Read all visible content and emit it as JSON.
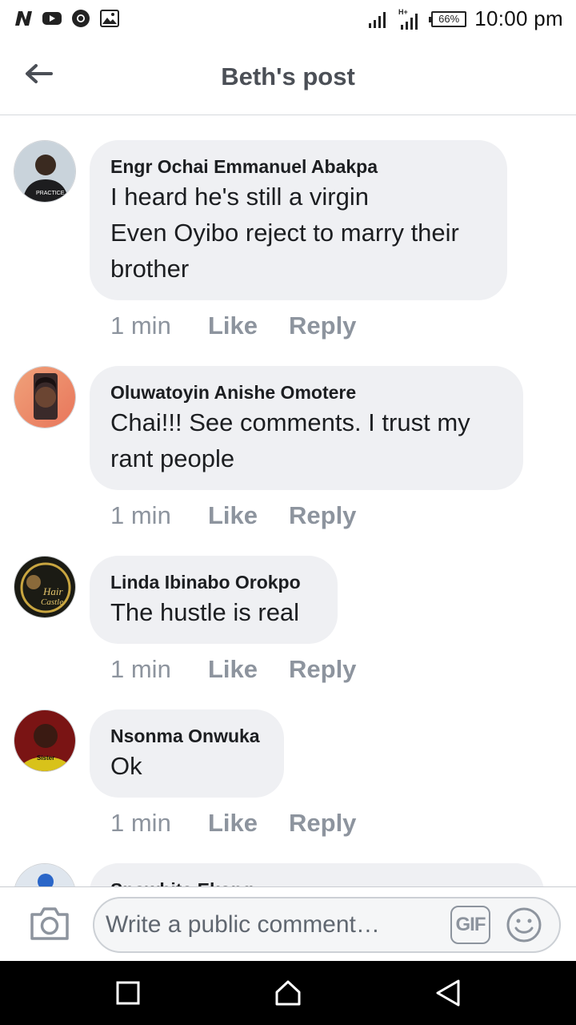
{
  "status_bar": {
    "left_icons": [
      "network-n-icon",
      "youtube-icon",
      "chrome-icon",
      "image-icon"
    ],
    "battery": "66%",
    "time": "10:00 pm"
  },
  "header": {
    "title": "Beth's post"
  },
  "comments": [
    {
      "author": "Engr Ochai Emmanuel Abakpa",
      "text": "I heard he's still a virgin\nEven Oyibo reject to marry their brother",
      "time": "1 min",
      "like": "Like",
      "reply": "Reply"
    },
    {
      "author": "Oluwatoyin Anishe Omotere",
      "text": "Chai!!! See comments. I trust my rant people",
      "time": "1 min",
      "like": "Like",
      "reply": "Reply"
    },
    {
      "author": "Linda Ibinabo Orokpo",
      "text": "The hustle is real",
      "time": "1 min",
      "like": "Like",
      "reply": "Reply"
    },
    {
      "author": "Nsonma Onwuka",
      "text": "Ok",
      "time": "1 min",
      "like": "Like",
      "reply": "Reply"
    },
    {
      "author": "Snowhite Ekong"
    }
  ],
  "composer": {
    "placeholder": "Write a public comment…",
    "gif_label": "GIF"
  },
  "colors": {
    "bubble": "#eff0f3",
    "meta_text": "#8d949e",
    "title_text": "#4b4f56"
  }
}
